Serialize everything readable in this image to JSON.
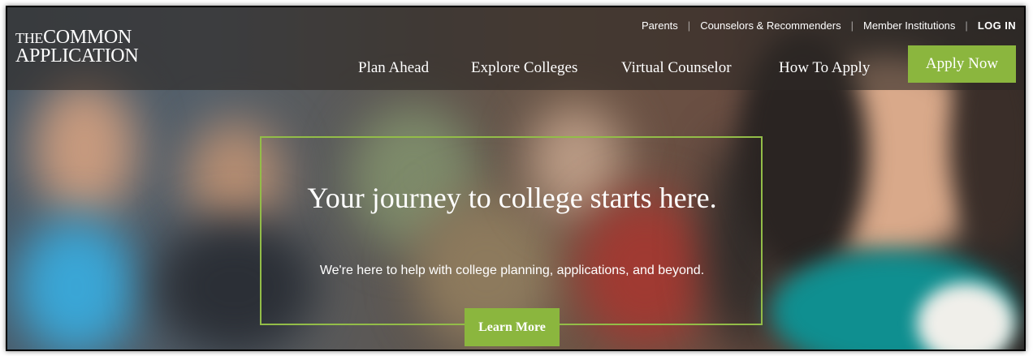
{
  "logo": {
    "line1_small": "THE",
    "line1": "COMMON",
    "line2": "APPLICATION"
  },
  "utility_nav": [
    {
      "label": "Parents"
    },
    {
      "label": "Counselors & Recommenders"
    },
    {
      "label": "Member Institutions"
    },
    {
      "label": "LOG IN"
    }
  ],
  "main_nav": [
    {
      "label": "Plan Ahead"
    },
    {
      "label": "Explore Colleges"
    },
    {
      "label": "Virtual Counselor"
    },
    {
      "label": "How To Apply"
    }
  ],
  "apply_button": "Apply Now",
  "hero": {
    "headline": "Your journey to college starts here.",
    "subtext": "We're here to help with college planning, applications, and beyond.",
    "cta": "Learn More"
  },
  "colors": {
    "accent_green": "#8bb63e",
    "frame_green": "#93bd48",
    "header_overlay": "#2d2825"
  }
}
